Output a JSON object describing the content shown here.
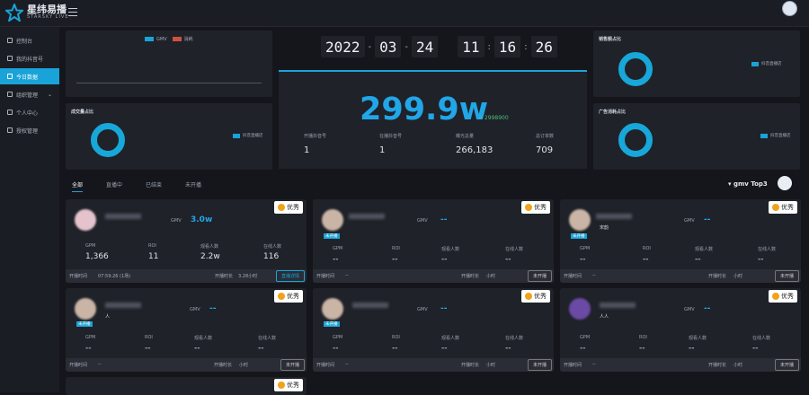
{
  "brand": {
    "name": "星纬易播",
    "sub": "STARSKY LIVE"
  },
  "sidebar": {
    "items": [
      {
        "label": "控制台"
      },
      {
        "label": "我的抖音号"
      },
      {
        "label": "今日数据"
      },
      {
        "label": "组织管理"
      },
      {
        "label": "个人中心"
      },
      {
        "label": "授权管理"
      }
    ]
  },
  "left_chart": {
    "legend": [
      {
        "label": "GMV",
        "color": "#1aa3d8"
      },
      {
        "label": "消耗",
        "color": "#d1503f"
      }
    ]
  },
  "deal_panel": {
    "title": "成交量占比",
    "legend": "抖音直播店"
  },
  "sales_panel": {
    "title": "销售额占比",
    "legend": "抖音直播店"
  },
  "ad_panel": {
    "title": "广告消耗占比",
    "legend": "抖音直播店"
  },
  "clock": {
    "year": "2022",
    "month": "03",
    "day": "24",
    "hh": "11",
    "mm": "16",
    "ss": "26"
  },
  "summary": {
    "value": "299.9w",
    "sub": "↗ 2998900",
    "stats": [
      {
        "label": "开播抖音号",
        "value": "1"
      },
      {
        "label": "在播抖音号",
        "value": "1"
      },
      {
        "label": "曝光总量",
        "value": "266,183"
      },
      {
        "label": "总订单数",
        "value": "709"
      }
    ]
  },
  "tabs": {
    "items": [
      "全部",
      "直播中",
      "已结束",
      "未开播"
    ]
  },
  "top3": "▾ gmv Top3",
  "badge": "优秀",
  "card_labels": {
    "gmv": "GMV",
    "gpm": "GPM",
    "roi": "ROI",
    "viewers": "观看人数",
    "online": "在线人数",
    "start": "开播时间",
    "duration": "开播时长",
    "not_live": "未开播",
    "live": "直播详情"
  },
  "cards": [
    {
      "gmv": "3.0w",
      "gpm": "1,366",
      "roi": "11",
      "viewers": "2.2w",
      "online": "116",
      "start": "07:59:26 (1场)",
      "duration": "3.28小时",
      "tag": ""
    },
    {
      "gmv": "--",
      "gpm": "--",
      "roi": "--",
      "viewers": "--",
      "online": "--",
      "start": "--",
      "duration": "小时",
      "tag": "未开播"
    },
    {
      "gmv": "--",
      "gpm": "--",
      "roi": "--",
      "viewers": "--",
      "online": "--",
      "start": "--",
      "duration": "小时",
      "tag": "未开播",
      "sub": "宋韵"
    },
    {
      "gmv": "--",
      "gpm": "--",
      "roi": "--",
      "viewers": "--",
      "online": "--",
      "start": "--",
      "duration": "小时",
      "tag": "未开播",
      "sub": "人"
    },
    {
      "gmv": "--",
      "gpm": "--",
      "roi": "--",
      "viewers": "--",
      "online": "--",
      "start": "--",
      "duration": "小时",
      "tag": "未开播",
      "sub": ""
    },
    {
      "gmv": "--",
      "gpm": "--",
      "roi": "--",
      "viewers": "--",
      "online": "--",
      "start": "--",
      "duration": "小时",
      "tag": "",
      "sub": "人人"
    }
  ]
}
